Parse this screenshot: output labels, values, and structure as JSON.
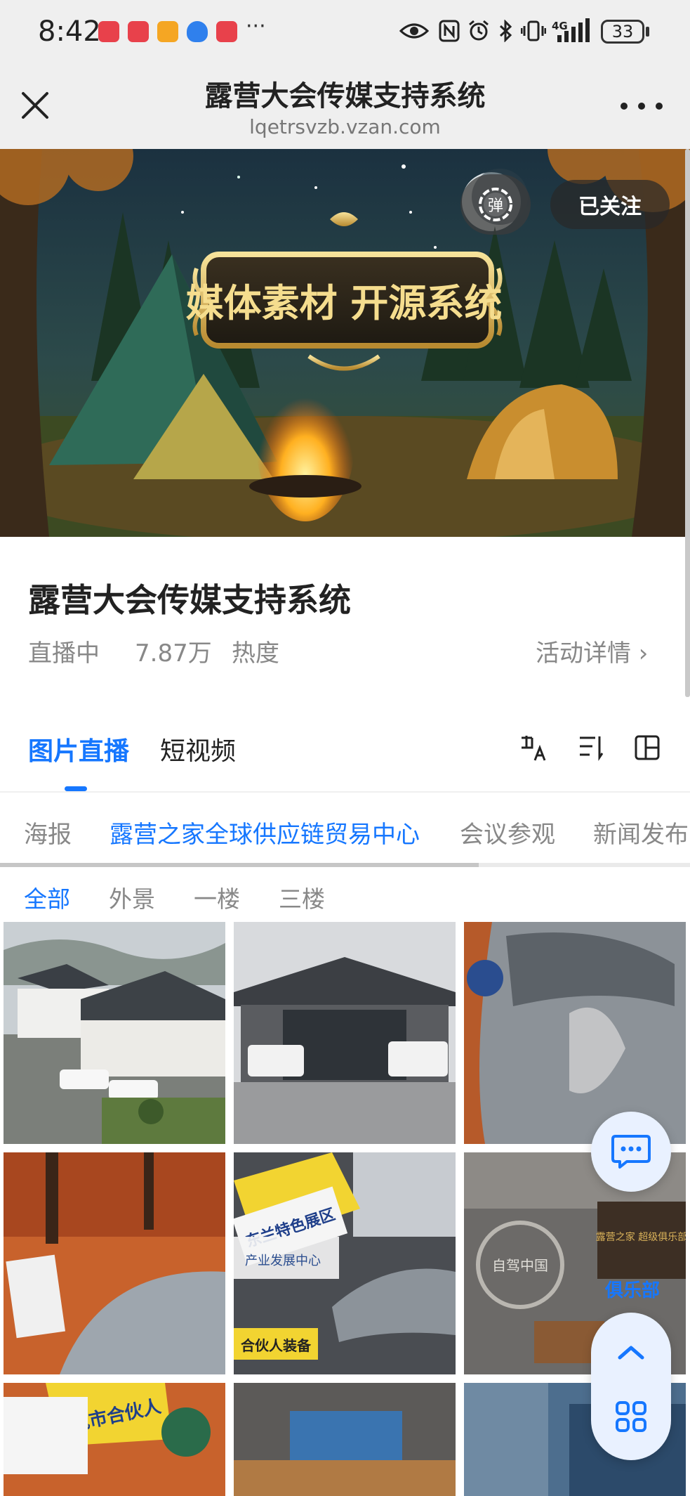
{
  "status_bar": {
    "time": "8:42",
    "more": "···",
    "network": "4G",
    "battery": "33",
    "icons": [
      "eye-icon",
      "nfc-icon",
      "alarm-icon",
      "bluetooth-icon",
      "vibrate-icon",
      "signal-icon"
    ]
  },
  "header": {
    "title": "露营大会传媒支持系统",
    "url": "lqetrsvzb.vzan.com"
  },
  "banner": {
    "headline": "媒体素材 开源系统",
    "danmu_label": "弹",
    "follow_label": "已关注"
  },
  "event": {
    "title": "露营大会传媒支持系统",
    "status": "直播中",
    "heat_value": "7.87万",
    "heat_label": "热度",
    "detail_link": "活动详情 ›"
  },
  "tabs": [
    {
      "label": "图片直播",
      "active": true
    },
    {
      "label": "短视频",
      "active": false
    }
  ],
  "categories": [
    {
      "label": "海报"
    },
    {
      "label": "露营之家全球供应链贸易中心"
    },
    {
      "label": "会议参观"
    },
    {
      "label": "新闻发布"
    }
  ],
  "subfilters": [
    {
      "label": "全部"
    },
    {
      "label": "外景"
    },
    {
      "label": "一楼"
    },
    {
      "label": "三楼"
    }
  ],
  "photo_texts": {
    "sign_a": "东兰特色展区",
    "sign_b": "产业发展中心",
    "sign_c": "合伙人装备",
    "sign_d": "城市合伙人",
    "club": "露营之家 超级俱乐部",
    "club_short": "俱乐部",
    "stamp": "自驾中国"
  },
  "colors": {
    "accent": "#1677ff",
    "muted": "#888888",
    "float_bg": "#e9f1ff"
  }
}
